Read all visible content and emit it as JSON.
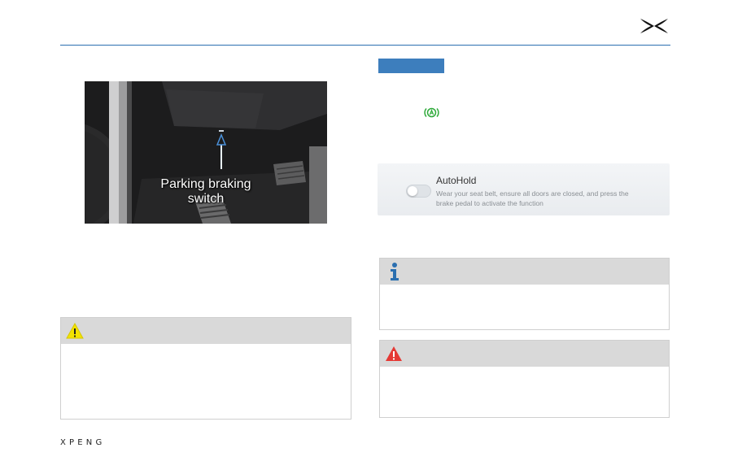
{
  "header": {
    "logo": "xpeng-x-logo"
  },
  "photo": {
    "caption_line1": "Parking braking",
    "caption_line2": "switch"
  },
  "notices": {
    "warning_icon": "warning-triangle-yellow-icon",
    "info_icon": "info-i-icon",
    "danger_icon": "danger-triangle-red-icon"
  },
  "autohold_indicator": {
    "icon": "autohold-a-icon",
    "color": "#2eaa3a"
  },
  "autohold_panel": {
    "title": "AutoHold",
    "description": "Wear your seat belt, ensure all doors are closed, and press the brake pedal to activate the function",
    "toggle_state": "off"
  },
  "colors": {
    "accent": "#2b6fb0",
    "tag": "#3d7ebd",
    "warning": "#f2e200",
    "danger": "#e53935"
  },
  "footer": {
    "wordmark": "XPENG"
  }
}
